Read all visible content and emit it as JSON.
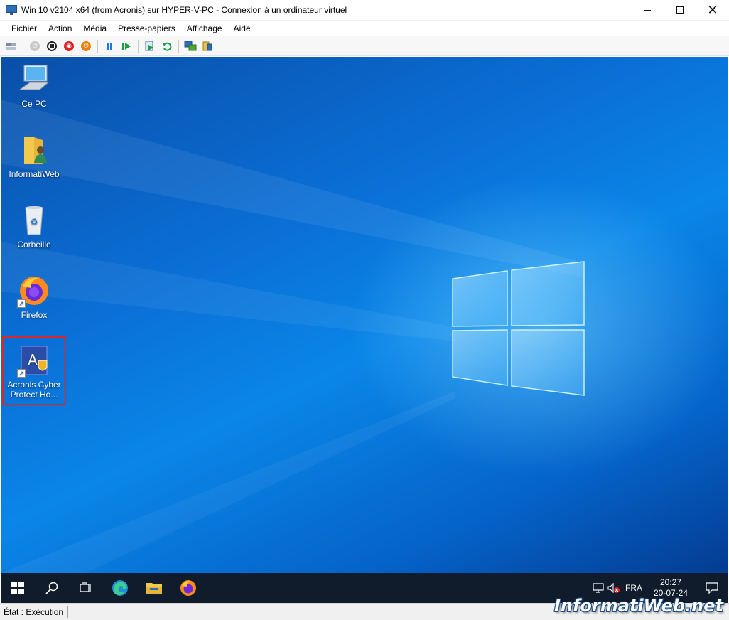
{
  "window": {
    "title": "Win 10 v2104 x64 (from Acronis) sur HYPER-V-PC - Connexion à un ordinateur virtuel",
    "minimize_icon": "minimize-icon",
    "maximize_icon": "maximize-icon",
    "close_icon": "close-icon"
  },
  "menu": {
    "items": [
      "Fichier",
      "Action",
      "Média",
      "Presse-papiers",
      "Affichage",
      "Aide"
    ]
  },
  "toolbar": {
    "buttons": [
      "ctrl-alt-del-icon",
      "start-icon",
      "turn-off-icon",
      "shut-down-icon",
      "save-state-icon",
      "pause-icon",
      "resume-icon",
      "checkpoint-icon",
      "revert-icon",
      "enhanced-session-icon",
      "share-icon"
    ]
  },
  "desktop": {
    "icons": [
      {
        "label": "Ce PC",
        "icon": "this-pc-icon"
      },
      {
        "label": "InformatiWeb",
        "icon": "user-folder-icon"
      },
      {
        "label": "Corbeille",
        "icon": "recycle-bin-icon"
      },
      {
        "label": "Firefox",
        "icon": "firefox-icon"
      },
      {
        "label": "Acronis Cyber Protect Ho...",
        "icon": "acronis-icon",
        "selected": true
      }
    ]
  },
  "taskbar": {
    "apps": [
      "start-icon",
      "search-icon",
      "task-view-icon",
      "edge-icon",
      "file-explorer-icon",
      "firefox-icon"
    ],
    "tray": {
      "network_icon": "network-icon",
      "volume_icon": "volume-muted-icon",
      "language": "FRA",
      "time": "20:27",
      "date": "20-07-24",
      "notification_icon": "notification-icon"
    }
  },
  "statusbar": {
    "status": "État : Exécution"
  },
  "watermark": "InformatiWeb.net",
  "colors": {
    "selection_border": "#d62a2a",
    "taskbar": "#101c2c",
    "desktop_blue": "#0a6fd6"
  }
}
